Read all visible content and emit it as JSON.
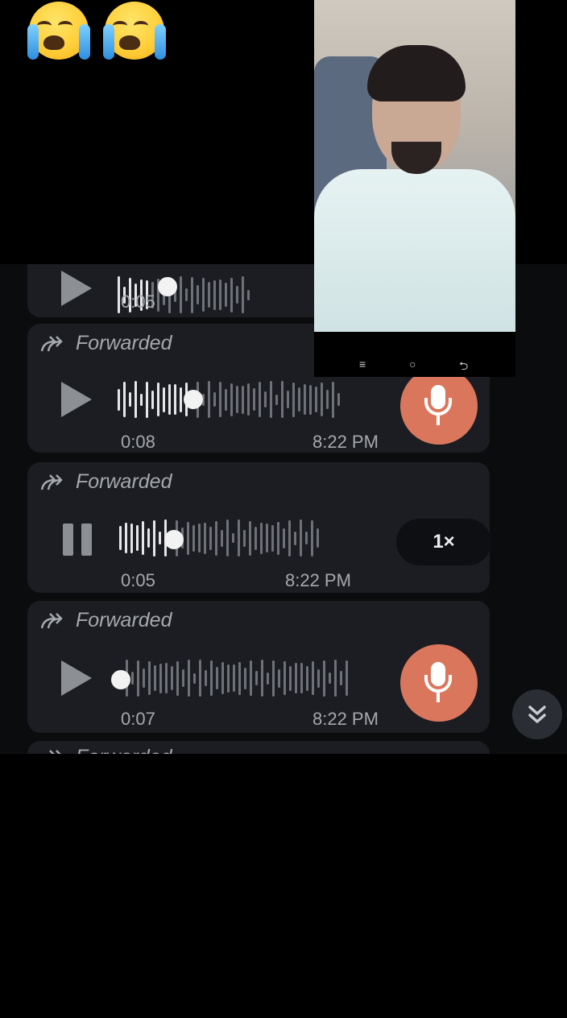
{
  "header": {
    "emojis": [
      "loudly-crying-face",
      "loudly-crying-face"
    ]
  },
  "messages": [
    {
      "forwarded_label": "",
      "duration": "0:05",
      "time": "",
      "state": "paused",
      "progress": 0.3
    },
    {
      "forwarded_label": "Forwarded",
      "duration": "0:08",
      "time": "8:22 PM",
      "state": "paused",
      "progress": 0.33
    },
    {
      "forwarded_label": "Forwarded",
      "duration": "0:05",
      "time": "8:22 PM",
      "state": "playing",
      "progress": 0.24,
      "speed": "1×"
    },
    {
      "forwarded_label": "Forwarded",
      "duration": "0:07",
      "time": "8:22 PM",
      "state": "paused",
      "progress": 0.0
    }
  ],
  "next_message_label": "Forwarded",
  "video_call": {
    "nav_icons": [
      "≡",
      "○",
      "⮌"
    ]
  },
  "colors": {
    "chat_bg": "#0b0c0e",
    "bubble_bg": "#1b1d22",
    "mic_accent": "#d9765c"
  }
}
